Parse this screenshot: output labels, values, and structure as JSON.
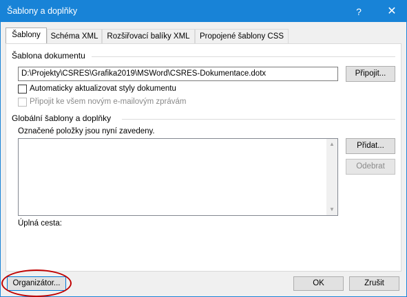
{
  "window": {
    "title": "Šablony a doplňky",
    "help_label": "?",
    "close_label": "✕"
  },
  "tabs": [
    {
      "label": "Šablony",
      "active": true
    },
    {
      "label": "Schéma XML",
      "active": false
    },
    {
      "label": "Rozšiřovací balíky XML",
      "active": false
    },
    {
      "label": "Propojené šablony CSS",
      "active": false
    }
  ],
  "template_group": {
    "label": "Šablona dokumentu",
    "path_value": "D:\\Projekty\\CSRES\\Grafika2019\\MSWord\\CSRES-Dokumentace.dotx",
    "attach_button": "Připojit...",
    "auto_update_label": "Automaticky aktualizovat styly dokumentu",
    "auto_update_checked": false,
    "attach_email_label": "Připojit ke všem novým e-mailovým zprávám",
    "attach_email_checked": false
  },
  "global_group": {
    "label": "Globální šablony a doplňky",
    "checked_items_label": "Označené položky jsou nyní zavedeny.",
    "items": [],
    "add_button": "Přidat...",
    "remove_button": "Odebrat",
    "full_path_label": "Úplná cesta:"
  },
  "footer": {
    "organizer_button": "Organizátor...",
    "ok_button": "OK",
    "cancel_button": "Zrušit"
  },
  "colors": {
    "titlebar": "#1883d7",
    "highlight": "#c00000"
  },
  "icons": {
    "help": "question-mark",
    "close": "x-close",
    "scroll_up": "triangle-up",
    "scroll_down": "triangle-down"
  }
}
